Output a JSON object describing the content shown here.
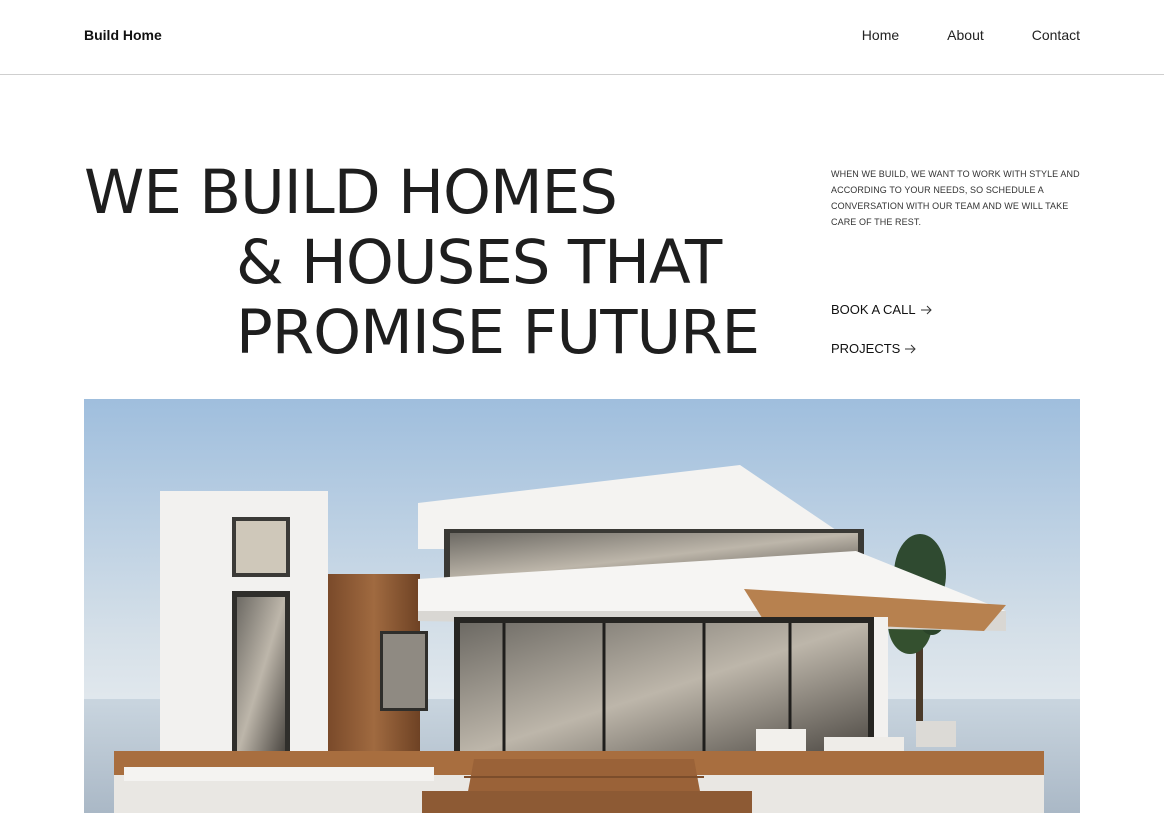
{
  "header": {
    "brand": "Build Home",
    "nav": [
      {
        "label": "Home"
      },
      {
        "label": "About"
      },
      {
        "label": "Contact"
      }
    ]
  },
  "hero": {
    "headline": {
      "line1": "WE BUILD HOMES",
      "line2": "& HOUSES THAT",
      "line3": "PROMISE FUTURE"
    },
    "blurb": "WHEN WE BUILD, WE WANT TO WORK WITH STYLE AND ACCORDING TO YOUR NEEDS, SO SCHEDULE A CONVERSATION WITH OUR TEAM AND WE WILL TAKE CARE OF THE REST.",
    "cta_book": "BOOK A CALL",
    "cta_projects": "PROJECTS",
    "arrow_icon": "arrow-right-icon"
  },
  "colors": {
    "text": "#1e1e1e",
    "divider": "#cfcfcf",
    "sky": "#a9c4df",
    "wood": "#8a5a34"
  }
}
